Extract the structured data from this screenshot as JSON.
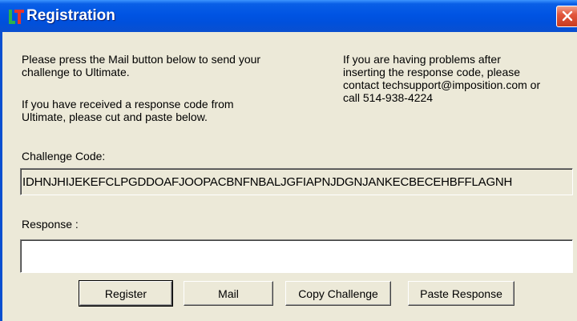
{
  "window": {
    "title": "Registration",
    "close_symbol": "×"
  },
  "instructions": {
    "mail_line1": "Please press the Mail button below to send your",
    "mail_line2": "challenge to Ultimate.",
    "response_line1": "If you have received a response code from",
    "response_line2": "Ultimate, please cut and paste below.",
    "support_line1": "If you are having problems after",
    "support_line2": "inserting the response code, please",
    "support_line3": "contact techsupport@imposition.com or",
    "support_line4": "call 514-938-4224"
  },
  "challenge": {
    "label": "Challenge Code:",
    "value": "IDHNJHIJEKEFCLPGDDOAFJOOPACBNFNBALJGFIAPNJDGNJANKECBECEHBFFLAGNH"
  },
  "response": {
    "label": "Response :",
    "value": ""
  },
  "buttons": {
    "register": "Register",
    "mail": "Mail",
    "copy_challenge": "Copy Challenge",
    "paste_response": "Paste Response"
  },
  "colors": {
    "titlebar": "#0054e3",
    "dialog_bg": "#ece9d8",
    "close_button": "#e2563c"
  }
}
